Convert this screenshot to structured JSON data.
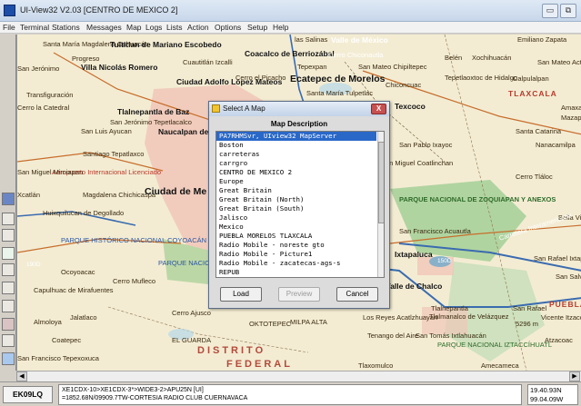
{
  "window": {
    "title": "UI-View32 V2.03 [CENTRO DE MEXICO 2]",
    "min_label": "▭",
    "max_label": "⧉"
  },
  "menu": [
    "File",
    "Terminal",
    "Stations",
    "Messages",
    "Map",
    "Logs",
    "Lists",
    "Action",
    "Options",
    "Setup",
    "Help"
  ],
  "map_labels": [
    "Santa María Magdalena Cahuacán",
    "Tultitlan de Mariano Escobedo",
    "Coacalco de Berriozábal",
    "las Salinas",
    "Valle de México",
    "Cerro Chiconautla",
    "Emiliano Zapata",
    "San Jerónimo",
    "Progreso",
    "Villa Nicolás Romero",
    "Cuautitlán Izcalli",
    "Tepexpan",
    "San Mateo Chipiltepec",
    "Belén",
    "Xochihuacán",
    "San Mateo Actipan",
    "Ciudad Adolfo López Mateos",
    "Cerro el Picacho",
    "Ecatepec de Morelos",
    "Chiconcuac",
    "Tepetlaoxtoc de Hidalgo",
    "Calpulalpan",
    "Transfiguración",
    "Santa María Tulpetlac",
    "Tlalnepantla de Baz",
    "Texcoco",
    "TLAXCALA",
    "Cerro la Catedral",
    "San Jerónimo Tepetlacalco",
    "Amaxac",
    "Mazapa",
    "San Luis Ayucan",
    "Naucalpan de Juárez",
    "Santa Catarina",
    "Nanacamilpa",
    "Santiago Tepatlaxco",
    "San Pablo Ixayoc",
    "San Miguel Coatlinchan",
    "Aeropuerto Internacional Licenciado",
    "San Miguel Mimiapan",
    "Cerro Tláloc",
    "Xcatlán",
    "Magdalena Chichicaspa",
    "Ciudad de Me",
    "PARQUE NACIONAL DE ZOQUIAPAN Y ANEXOS",
    "Huixquilucan de Degollado",
    "Bella Vista",
    "San Francisco Acuautla",
    "Carretera Interamericana",
    "PARQUE HISTÓRICO NACIONAL COYOACÁN",
    "PARQUE NACIONAL LOS LEONES",
    "Ixtapaluca",
    "San Rafael Ixtapaluca",
    "Ocoyoacac",
    "Cerro Mufleco",
    "San Salvador el Verde",
    "Capulhuac de Mirafuentes",
    "Valle de Chalco",
    "Los Reyes Acatlzhuayan",
    "Tlalnepantla",
    "PUEBLA",
    "Almoloya",
    "Jalatlaco",
    "Cerro Ajusco",
    "OKTOTEPEC",
    "MILPA ALTA",
    "Tlalmanalco de Velázquez",
    "San Rafael",
    "Vicente Itzacoihuac",
    "Coatepec",
    "EL GUARDA",
    "Tenango del Aire",
    "San Tomás Ixtlahuacán",
    "PARQUE NACIONAL IZTACCÍHUATL",
    "Atzacoac",
    "DISTRITO",
    "FEDERAL",
    "San Francisco Tepexoxuca",
    "Tlaxomulco",
    "Amecameca",
    "5296 m"
  ],
  "highway_labels": [
    "150D",
    "190D"
  ],
  "dialog": {
    "title": "Select A Map",
    "close_label": "X",
    "description_header": "Map Description",
    "maps": [
      "PA7RHMSvr, UIview32 MapServer",
      "Boston",
      "carreteras",
      "carrgro",
      "CENTRO DE MEXICO 2",
      "Europe",
      "Great Britain",
      "Great Britain (North)",
      "Great Britain (South)",
      "Jalisco",
      "Mexico",
      "PUEBLA MORELOS TLAXCALA",
      "Radio Mobile - noreste gto",
      "Radio Mobile - Picture1",
      "Radio Mobile - zacatecas-ags-s",
      "REPUB"
    ],
    "selected_index": 0,
    "load_label": "Load",
    "preview_label": "Preview",
    "cancel_label": "Cancel"
  },
  "status": {
    "callsign": "EK09LQ",
    "packet_line1": "XE1CDX-10>XE1CDX-3*>WIDE3-2>APU25N [UI]",
    "packet_line2": "=1852.68N/09909.7TW-CORTESIA RADIO CLUB CUERNAVACA",
    "coord_line1": "19.40.93N",
    "coord_line2": "99.04.09W"
  },
  "colors": {
    "map_background": "#f3ecd3",
    "urban_area": "#f0c7b8",
    "park_green": "#8fc285",
    "roads": "#c86d2b",
    "highway": "#3a6bb0",
    "selection": "#2a68c8"
  }
}
